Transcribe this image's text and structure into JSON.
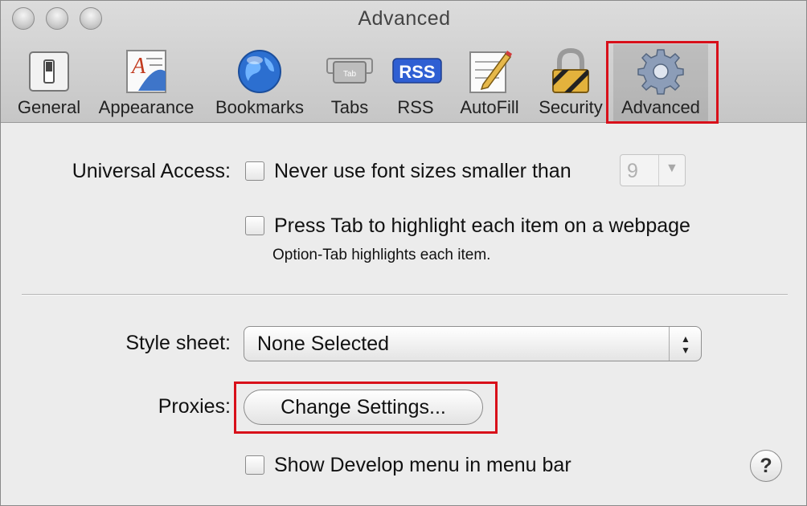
{
  "window": {
    "title": "Advanced"
  },
  "toolbar": {
    "items": [
      {
        "label": "General",
        "icon": "switch-icon"
      },
      {
        "label": "Appearance",
        "icon": "font-icon"
      },
      {
        "label": "Bookmarks",
        "icon": "globe-icon"
      },
      {
        "label": "Tabs",
        "icon": "tab-icon"
      },
      {
        "label": "RSS",
        "icon": "rss-icon"
      },
      {
        "label": "AutoFill",
        "icon": "pencil-icon"
      },
      {
        "label": "Security",
        "icon": "lock-icon"
      },
      {
        "label": "Advanced",
        "icon": "gear-icon"
      }
    ],
    "selected": "Advanced",
    "rss_badge_text": "RSS",
    "tab_icon_text": "Tab"
  },
  "universal_access": {
    "label": "Universal Access:",
    "font_size_option": "Never use font sizes smaller than",
    "font_size_value": "9",
    "tab_highlight_option": "Press Tab to highlight each item on a webpage",
    "tab_highlight_note": "Option-Tab highlights each item."
  },
  "style_sheet": {
    "label": "Style sheet:",
    "value": "None Selected"
  },
  "proxies": {
    "label": "Proxies:",
    "button": "Change Settings..."
  },
  "develop": {
    "option": "Show Develop menu in menu bar"
  },
  "help": {
    "label": "?"
  },
  "colors": {
    "highlight": "#d8101a",
    "rss_badge": "#2f5fd3"
  }
}
